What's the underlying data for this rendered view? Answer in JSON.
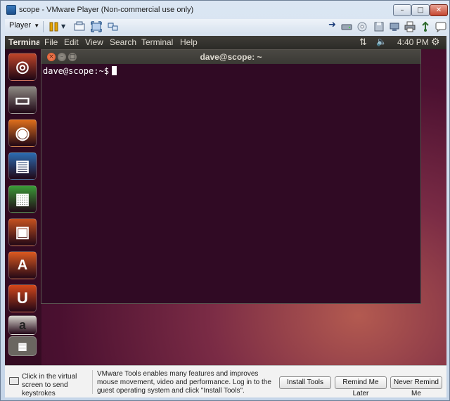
{
  "window": {
    "title": "scope - VMware Player (Non-commercial use only)",
    "min_glyph": "–",
    "max_glyph": "□",
    "close_glyph": "✕"
  },
  "toolbar": {
    "player_label": "Player",
    "dropdown_glyph": "▼"
  },
  "ubuntu_panel": {
    "app_name": "Terminal",
    "menus": [
      "File",
      "Edit",
      "View",
      "Search",
      "Terminal",
      "Help"
    ],
    "network_glyph": "⇅",
    "volume_glyph": "🔈",
    "clock": "4:40 PM",
    "session_glyph": "⚙"
  },
  "launcher": {
    "items": [
      {
        "name": "dash-home",
        "glyph": "◎",
        "color": "#c2462a"
      },
      {
        "name": "files",
        "glyph": "▭",
        "color": "#8f8b84"
      },
      {
        "name": "firefox",
        "glyph": "◉",
        "color": "#e0701c"
      },
      {
        "name": "writer",
        "glyph": "▤",
        "color": "#2d6db3"
      },
      {
        "name": "calc",
        "glyph": "▦",
        "color": "#3b9b38"
      },
      {
        "name": "impress",
        "glyph": "▣",
        "color": "#c6521f"
      },
      {
        "name": "software-center",
        "glyph": "A",
        "color": "#dd5a20"
      },
      {
        "name": "ubuntu-one",
        "glyph": "U",
        "color": "#d4481b"
      },
      {
        "name": "amazon",
        "glyph": "a",
        "color": "#d9d6cf"
      }
    ]
  },
  "terminal": {
    "title": "dave@scope: ~",
    "prompt": "dave@scope:~$"
  },
  "notification": {
    "hint": "Click in the virtual screen to send keystrokes",
    "message": "VMware Tools enables many features and improves mouse movement, video and performance. Log in to the guest operating system and click \"Install Tools\".",
    "install_label": "Install Tools",
    "later_label": "Remind Me Later",
    "never_label": "Never Remind Me"
  }
}
